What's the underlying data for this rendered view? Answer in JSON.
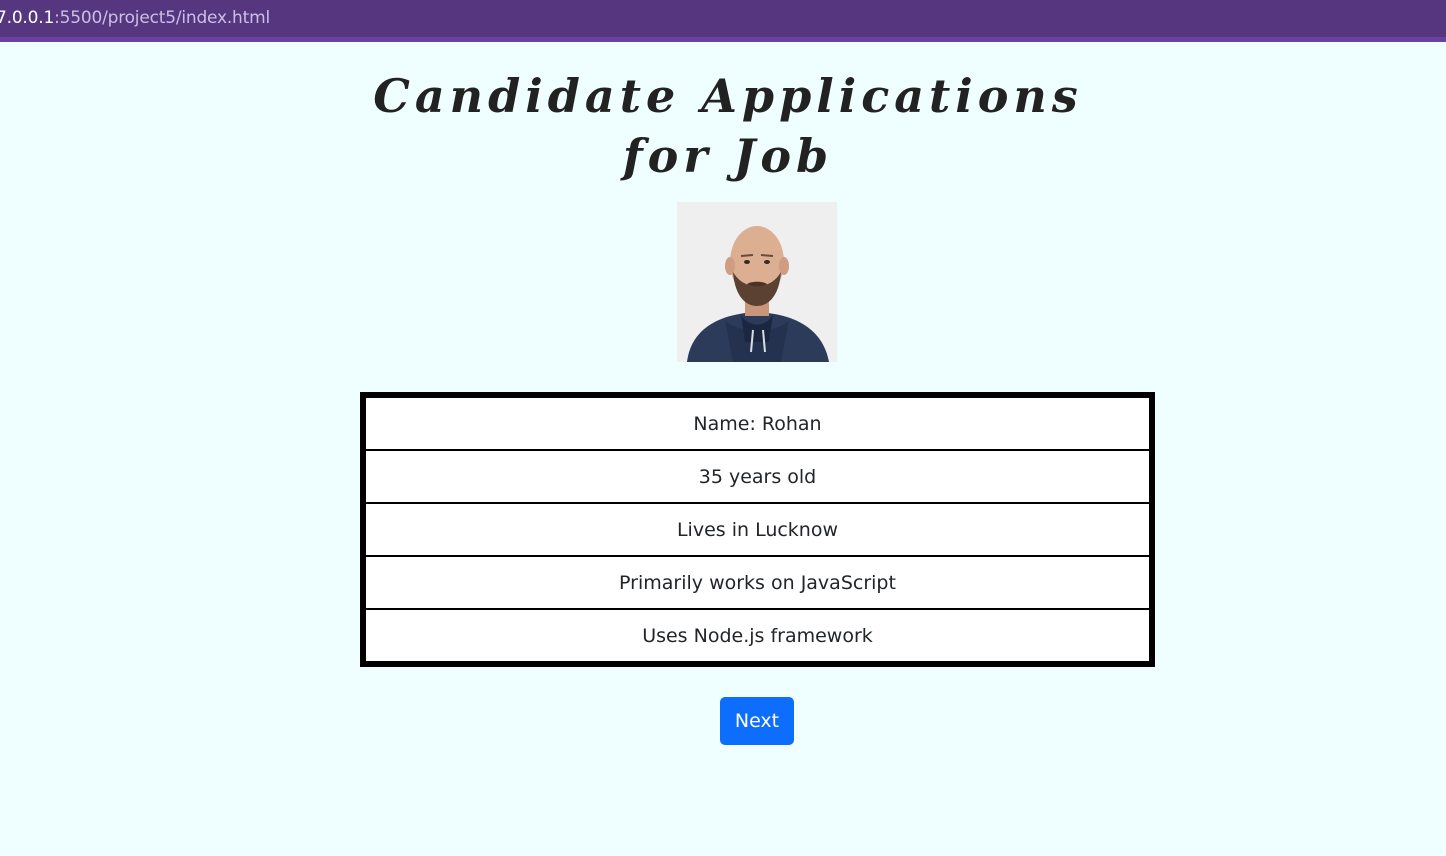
{
  "browser": {
    "url_host": "7.0.0.1",
    "url_path": ":5500/project5/index.html"
  },
  "page": {
    "title_line1": "Candidate Applications",
    "title_line2": "for Job"
  },
  "candidate": {
    "photo_alt": "candidate-photo",
    "rows": [
      "Name: Rohan",
      "35 years old",
      "Lives in Lucknow",
      "Primarily works on JavaScript",
      "Uses Node.js framework"
    ]
  },
  "actions": {
    "next_label": "Next"
  },
  "colors": {
    "background": "#efffff",
    "address_bar": "#56367f",
    "button": "#0d6efd"
  }
}
